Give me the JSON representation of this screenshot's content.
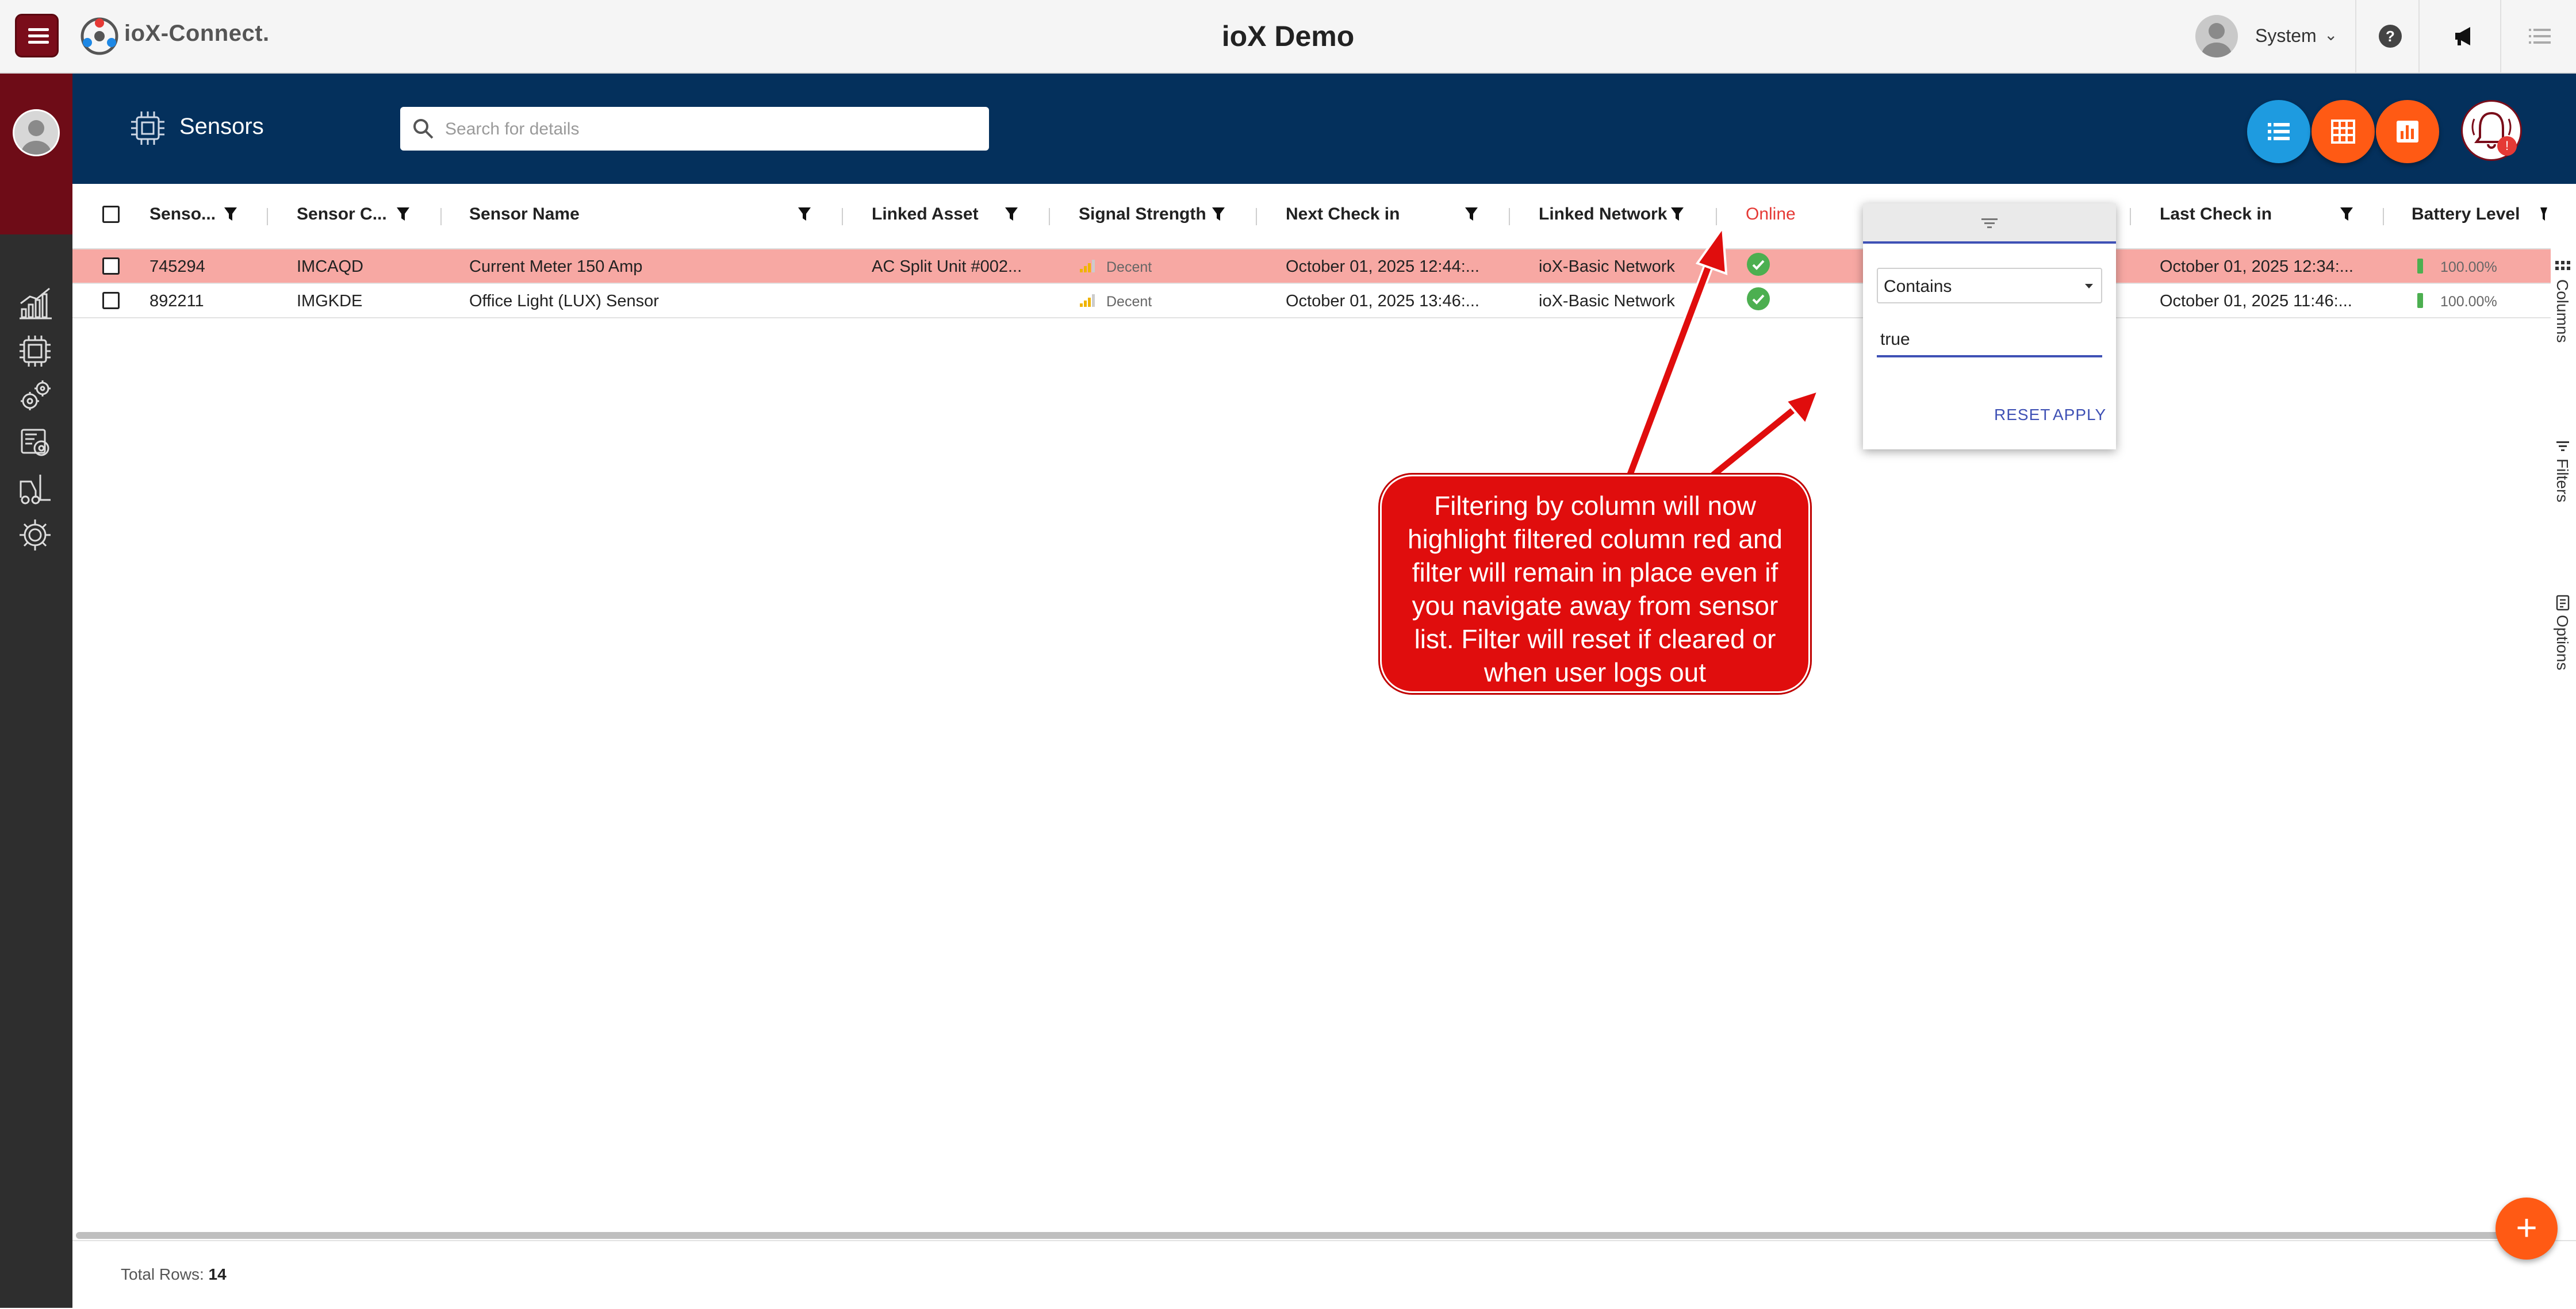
{
  "app": {
    "brand": "ioX-Connect.",
    "title": "ioX Demo",
    "user": "System"
  },
  "page": {
    "title": "Sensors",
    "search_placeholder": "Search for details"
  },
  "colors": {
    "maroon": "#7a0d1a",
    "navy": "#04305c",
    "accent_blue": "#1e9be0",
    "accent_orange": "#ff5a14",
    "row_highlight": "#f7a8a3",
    "filtered_header": "#e53935",
    "callout_red": "#e00d0d"
  },
  "grid": {
    "columns": [
      {
        "label": "Senso..."
      },
      {
        "label": "Sensor C..."
      },
      {
        "label": "Sensor Name"
      },
      {
        "label": "Linked Asset"
      },
      {
        "label": "Signal Strength"
      },
      {
        "label": "Next Check in"
      },
      {
        "label": "Linked Network"
      },
      {
        "label": "Online"
      },
      {
        "label": "Last Check in"
      },
      {
        "label": "Battery Level"
      }
    ],
    "rows": [
      {
        "id": "745294",
        "code": "IMCAQD",
        "name": "Current Meter 150 Amp",
        "asset": "AC Split Unit #002...",
        "signal": "Decent",
        "next_check": "October 01, 2025 12:44:...",
        "network": "ioX-Basic Network",
        "last_check": "October 01, 2025 12:34:...",
        "battery": "100.00%",
        "highlighted": true
      },
      {
        "id": "892211",
        "code": "IMGKDE",
        "name": "Office Light (LUX) Sensor",
        "asset": "",
        "signal": "Decent",
        "next_check": "October 01, 2025 13:46:...",
        "network": "ioX-Basic Network",
        "last_check": "October 01, 2025 11:46:...",
        "battery": "100.00%",
        "highlighted": false
      }
    ],
    "total_label": "Total Rows:",
    "total_value": "14"
  },
  "side_tabs": {
    "columns": "Columns",
    "filters": "Filters",
    "options": "Options"
  },
  "filter_popup": {
    "operator": "Contains",
    "value": "true",
    "reset": "RESET",
    "apply": "APPLY"
  },
  "annotation": {
    "lines": [
      "Filtering by column will now",
      "highlight filtered column red and",
      "filter will remain in place even if",
      "you navigate away from sensor",
      "list. Filter will reset if cleared or",
      "when user logs out"
    ]
  },
  "icons": {
    "menu": "hamburger-icon",
    "logo": "iox-logo-icon",
    "help": "help-icon",
    "announce": "megaphone-icon",
    "list": "list-icon",
    "search": "search-icon",
    "sensor": "chip-icon",
    "alarm": "alarm-bell-icon",
    "add": "plus-icon"
  }
}
